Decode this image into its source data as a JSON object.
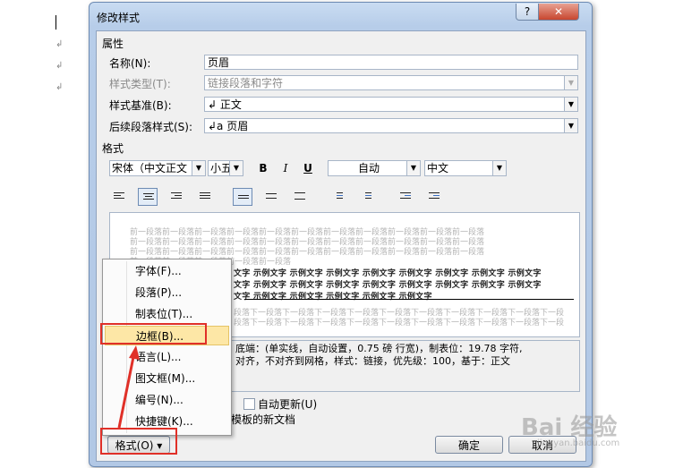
{
  "dialog": {
    "title": "修改样式",
    "help": "?",
    "close": "✕",
    "sections": {
      "properties": "属性",
      "format": "格式"
    },
    "properties": {
      "name_label": "名称(N):",
      "name_value": "页眉",
      "type_label": "样式类型(T):",
      "type_value": "链接段落和字符",
      "based_label": "样式基准(B):",
      "based_value": "↲ 正文",
      "next_label": "后续段落样式(S):",
      "next_value": "↲a 页眉"
    },
    "format": {
      "font": "宋体（中文正文",
      "size": "小五",
      "bold": "B",
      "italic": "I",
      "underline": "U",
      "color": "自动",
      "lang": "中文"
    },
    "preview": {
      "prev_line1": "前一段落前一段落前一段落前一段落前一段落前一段落前一段落前一段落前一段落前一段落前一段落",
      "prev_line2": "前一段落前一段落前一段落前一段落前一段落前一段落前一段落前一段落前一段落前一段落前一段落",
      "prev_line3": "前一段落前一段落前一段落前一段落前一段落前一段落前一段落前一段落前一段落前一段落前一段落",
      "prev_line4": "前一段落前一段落前一段落前一段落前一段落",
      "sample_line1": "文字 示例文字 示例文字 示例文字 示例文字 示例文字 示例文字 示例文字 示例文字",
      "sample_line2": "文字 示例文字 示例文字 示例文字 示例文字 示例文字 示例文字 示例文字 示例文字",
      "sample_line3": "文字 示例文字 示例文字 示例文字 示例文字 示例文字",
      "next_line1": "段落下一段落下一段落下一段落下一段落下一段落下一段落下一段落下一段落下一段落下一段",
      "next_line2": "段落下一段落下一段落下一段落下一段落下一段落下一段落下一段落下一段落下一段落下一段"
    },
    "description": {
      "line1": "底端：(单实线，自动设置，0.75 磅 行宽)，制表位：19.78 字符,",
      "line2": "对齐，不对齐到网格，样式：链接，优先级：100，基于：正文"
    },
    "options": {
      "auto_update": "自动更新(U)",
      "template": "模板的新文档"
    },
    "buttons": {
      "format": "格式(O) ▾",
      "ok": "确定",
      "cancel": "取消"
    }
  },
  "menu": {
    "items": [
      "字体(F)...",
      "段落(P)...",
      "制表位(T)...",
      "边框(B)...",
      "语言(L)...",
      "图文框(M)...",
      "编号(N)...",
      "快捷键(K)..."
    ],
    "highlighted_index": 3
  },
  "watermark": {
    "text": "Bai 经验",
    "sub": "jingyan.baidu.com"
  },
  "colors": {
    "annotation_red": "#e03028",
    "menu_highlight": "#fde7a6",
    "dialog_frame": "#b7cde9"
  }
}
